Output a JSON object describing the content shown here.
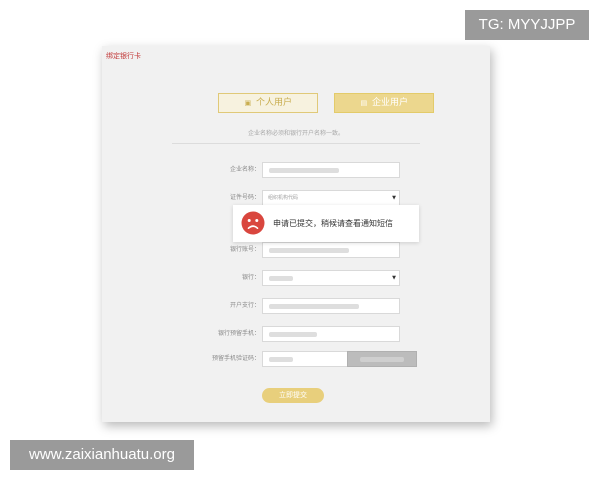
{
  "watermark": {
    "top": "TG: MYYJJPP",
    "bottom": "www.zaixianhuatu.org"
  },
  "dialog": {
    "title": "绑定银行卡"
  },
  "tabs": [
    {
      "label": "个人用户",
      "icon": "person-card-icon",
      "state": "inactive"
    },
    {
      "label": "企业用户",
      "icon": "enterprise-icon",
      "state": "active"
    }
  ],
  "notice": "企业名称必须和银行开户名称一致。",
  "form": {
    "company_name": {
      "label": "企业名称："
    },
    "id_type": {
      "label": "证件号码：",
      "selected": "组织机构代码"
    },
    "bank_account": {
      "label": "银行账号："
    },
    "bank": {
      "label": "银行："
    },
    "branch": {
      "label": "开户支行："
    },
    "phone": {
      "label": "银行预留手机："
    },
    "sms_code": {
      "label": "预留手机验证码："
    }
  },
  "submit_label": "立即提交",
  "toast": {
    "message": "申请已提交，稍候请查看通知短信",
    "icon": "sad-face-icon",
    "icon_color": "#d9463e"
  },
  "colors": {
    "accent_gold": "#e8cf7c",
    "title_red": "#c23a3a"
  }
}
